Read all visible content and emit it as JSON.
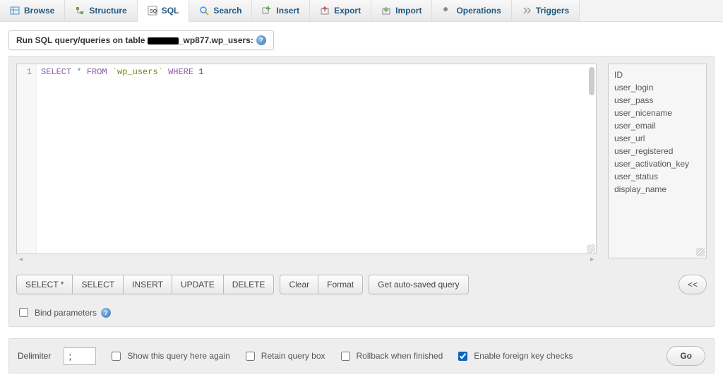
{
  "tabs": {
    "browse": "Browse",
    "structure": "Structure",
    "sql": "SQL",
    "search": "Search",
    "insert": "Insert",
    "export": "Export",
    "import": "Import",
    "operations": "Operations",
    "triggers": "Triggers"
  },
  "panel": {
    "run_prefix": "Run SQL query/queries on table ",
    "table_suffix": "_wp877.wp_users:"
  },
  "editor": {
    "line_number": "1",
    "sql_select": "SELECT",
    "sql_star": " * ",
    "sql_from": "FROM",
    "sql_space": " ",
    "sql_table": "`wp_users`",
    "sql_where": "WHERE",
    "sql_val": "1"
  },
  "columns": [
    "ID",
    "user_login",
    "user_pass",
    "user_nicename",
    "user_email",
    "user_url",
    "user_registered",
    "user_activation_key",
    "user_status",
    "display_name"
  ],
  "buttons": {
    "select_star": "SELECT *",
    "select": "SELECT",
    "insert": "INSERT",
    "update": "UPDATE",
    "delete": "DELETE",
    "clear": "Clear",
    "format": "Format",
    "autosaved": "Get auto-saved query",
    "collapse": "<<"
  },
  "bind_params": {
    "label": "Bind parameters"
  },
  "footer": {
    "delimiter_label": "Delimiter",
    "delimiter_value": ";",
    "show_again": "Show this query here again",
    "retain": "Retain query box",
    "rollback": "Rollback when finished",
    "fk_checks": "Enable foreign key checks",
    "go": "Go"
  }
}
